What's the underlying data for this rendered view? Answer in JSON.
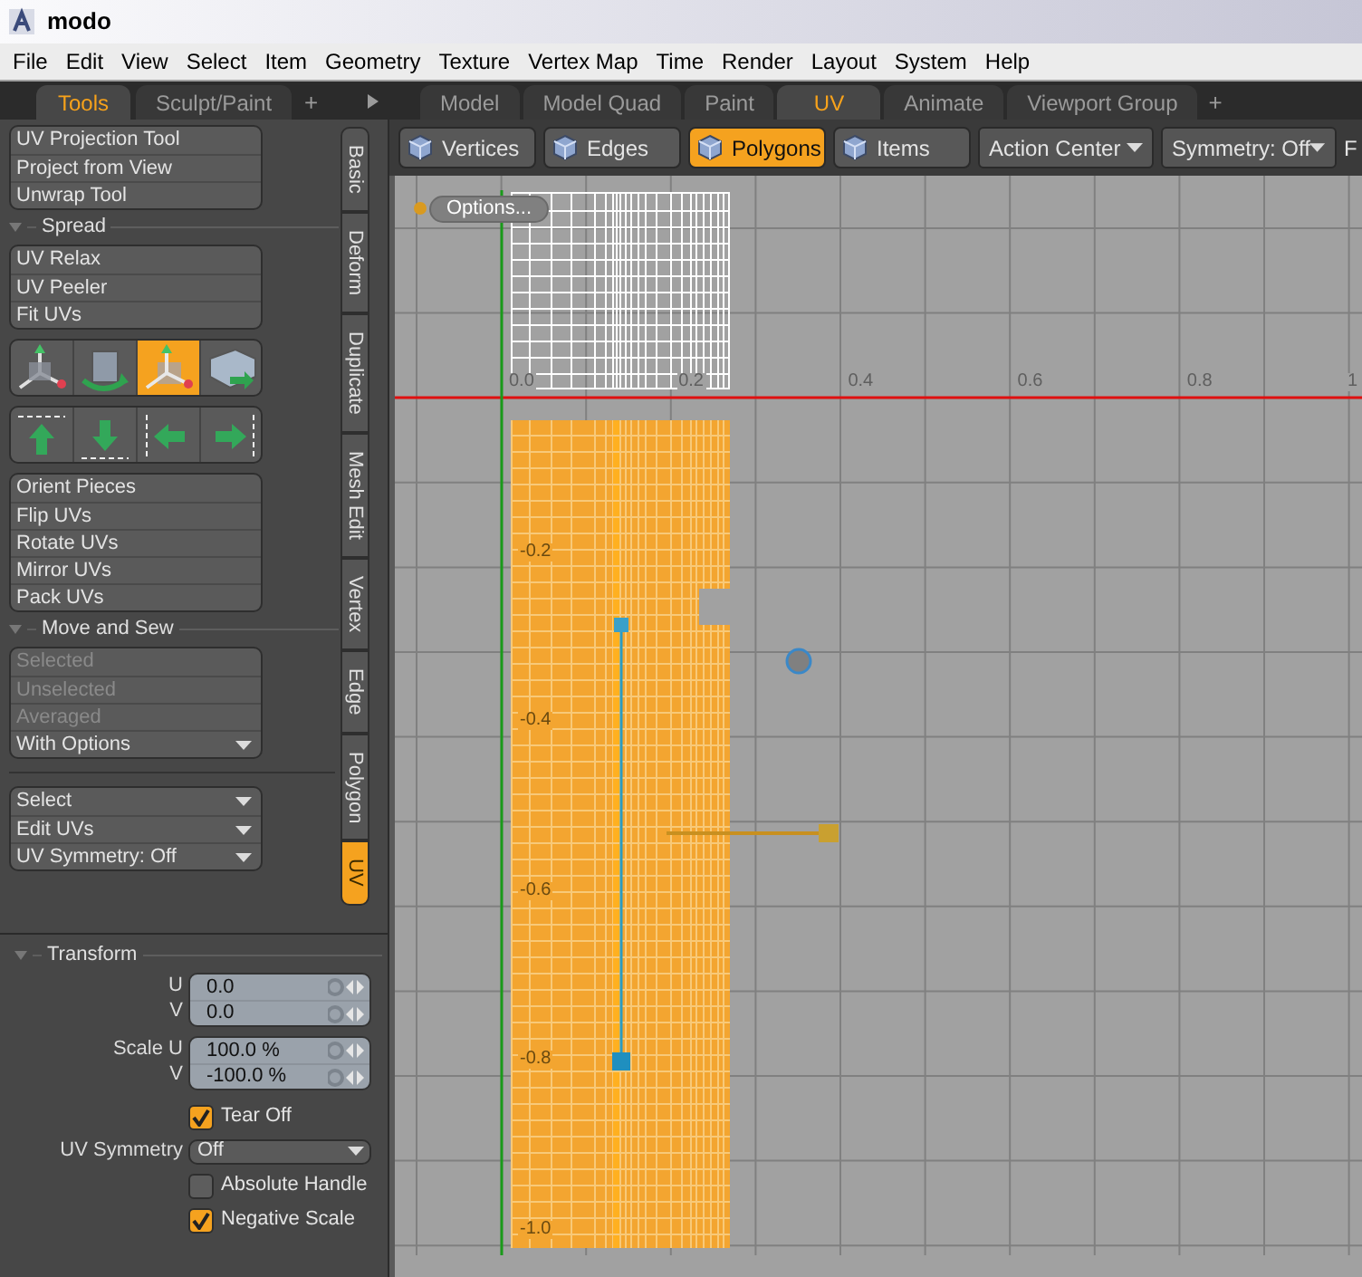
{
  "window": {
    "title": "modo"
  },
  "menu": [
    "File",
    "Edit",
    "View",
    "Select",
    "Item",
    "Geometry",
    "Texture",
    "Vertex Map",
    "Time",
    "Render",
    "Layout",
    "System",
    "Help"
  ],
  "panel_tabs": [
    {
      "label": "Tools",
      "selected": true
    },
    {
      "label": "Sculpt/Paint",
      "selected": false
    }
  ],
  "panel_tabs_add": "+",
  "layout_tabs": [
    {
      "label": "Model",
      "selected": false
    },
    {
      "label": "Model Quad",
      "selected": false
    },
    {
      "label": "Paint",
      "selected": false
    },
    {
      "label": "UV",
      "selected": true
    },
    {
      "label": "Animate",
      "selected": false
    },
    {
      "label": "Viewport Group",
      "selected": false
    }
  ],
  "layout_tabs_add": "+",
  "tool_sections": [
    {
      "kind": "buttons",
      "items": [
        {
          "label": "UV Projection Tool",
          "kind": "button"
        },
        {
          "label": "Project from View",
          "kind": "button"
        },
        {
          "label": "Unwrap Tool",
          "kind": "button"
        }
      ]
    },
    {
      "kind": "header",
      "title": "Spread"
    },
    {
      "kind": "buttons",
      "items": [
        {
          "label": "UV Relax",
          "kind": "button"
        },
        {
          "label": "UV Peeler",
          "kind": "button"
        },
        {
          "label": "Fit UVs",
          "kind": "button"
        }
      ]
    },
    {
      "kind": "icons",
      "items": [
        {
          "kind": "move",
          "selected": false
        },
        {
          "kind": "rotate",
          "selected": false
        },
        {
          "kind": "transform",
          "selected": true
        },
        {
          "kind": "push",
          "selected": false
        }
      ]
    },
    {
      "kind": "icons",
      "items": [
        {
          "kind": "align-top"
        },
        {
          "kind": "align-bottom"
        },
        {
          "kind": "align-left"
        },
        {
          "kind": "align-right"
        }
      ]
    },
    {
      "kind": "buttons",
      "items": [
        {
          "label": "Orient Pieces",
          "kind": "button"
        },
        {
          "label": "Flip UVs",
          "kind": "button"
        },
        {
          "label": "Rotate UVs",
          "kind": "button"
        },
        {
          "label": "Mirror UVs",
          "kind": "button"
        },
        {
          "label": "Pack UVs",
          "kind": "button"
        }
      ]
    },
    {
      "kind": "header",
      "title": "Move and Sew"
    },
    {
      "kind": "buttons",
      "items": [
        {
          "label": "Selected",
          "kind": "button",
          "disabled": true
        },
        {
          "label": "Unselected",
          "kind": "button",
          "disabled": true
        },
        {
          "label": "Averaged",
          "kind": "button",
          "disabled": true
        },
        {
          "label": "With Options",
          "kind": "dropdown",
          "disabled": false
        }
      ]
    },
    {
      "kind": "divider"
    },
    {
      "kind": "buttons",
      "items": [
        {
          "label": "Select",
          "kind": "dropdown"
        },
        {
          "label": "Edit UVs",
          "kind": "dropdown"
        },
        {
          "label": "UV Symmetry: Off",
          "kind": "dropdown"
        }
      ]
    }
  ],
  "side_tabs": [
    {
      "label": "Basic",
      "selected": false
    },
    {
      "label": "Deform",
      "selected": false
    },
    {
      "label": "Duplicate",
      "selected": false
    },
    {
      "label": "Mesh Edit",
      "selected": false
    },
    {
      "label": "Vertex",
      "selected": false
    },
    {
      "label": "Edge",
      "selected": false
    },
    {
      "label": "Polygon",
      "selected": false
    },
    {
      "label": "UV",
      "selected": true
    }
  ],
  "transform": {
    "title": "Transform",
    "field_groups": [
      [
        {
          "label": "U",
          "value": "0.0"
        },
        {
          "label": "V",
          "value": "0.0"
        }
      ],
      [
        {
          "label": "Scale U",
          "value": "100.0 %"
        },
        {
          "label": "V",
          "value": "-100.0 %"
        }
      ]
    ],
    "options": [
      {
        "kind": "checkbox",
        "label": "Tear Off",
        "checked": true
      },
      {
        "kind": "dropdown",
        "label": "UV Symmetry",
        "value": "Off"
      },
      {
        "kind": "checkbox",
        "label": "Absolute Handle",
        "checked": false
      },
      {
        "kind": "checkbox",
        "label": "Negative Scale",
        "checked": true
      }
    ]
  },
  "viewport_toolbar": {
    "modes": [
      {
        "label": "Vertices",
        "selected": false
      },
      {
        "label": "Edges",
        "selected": false
      },
      {
        "label": "Polygons",
        "selected": true
      },
      {
        "label": "Items",
        "selected": false
      }
    ],
    "dropdowns": [
      "Action Center",
      "Symmetry: Off"
    ],
    "cut_label": "F"
  },
  "viewport": {
    "options_button": "Options...",
    "u_labels": [
      "0.0",
      "0.2",
      "0.4",
      "0.6",
      "0.8",
      "1"
    ],
    "v_labels": [
      "-0.2",
      "-0.4",
      "-0.6",
      "-0.8",
      "-1.0"
    ]
  }
}
